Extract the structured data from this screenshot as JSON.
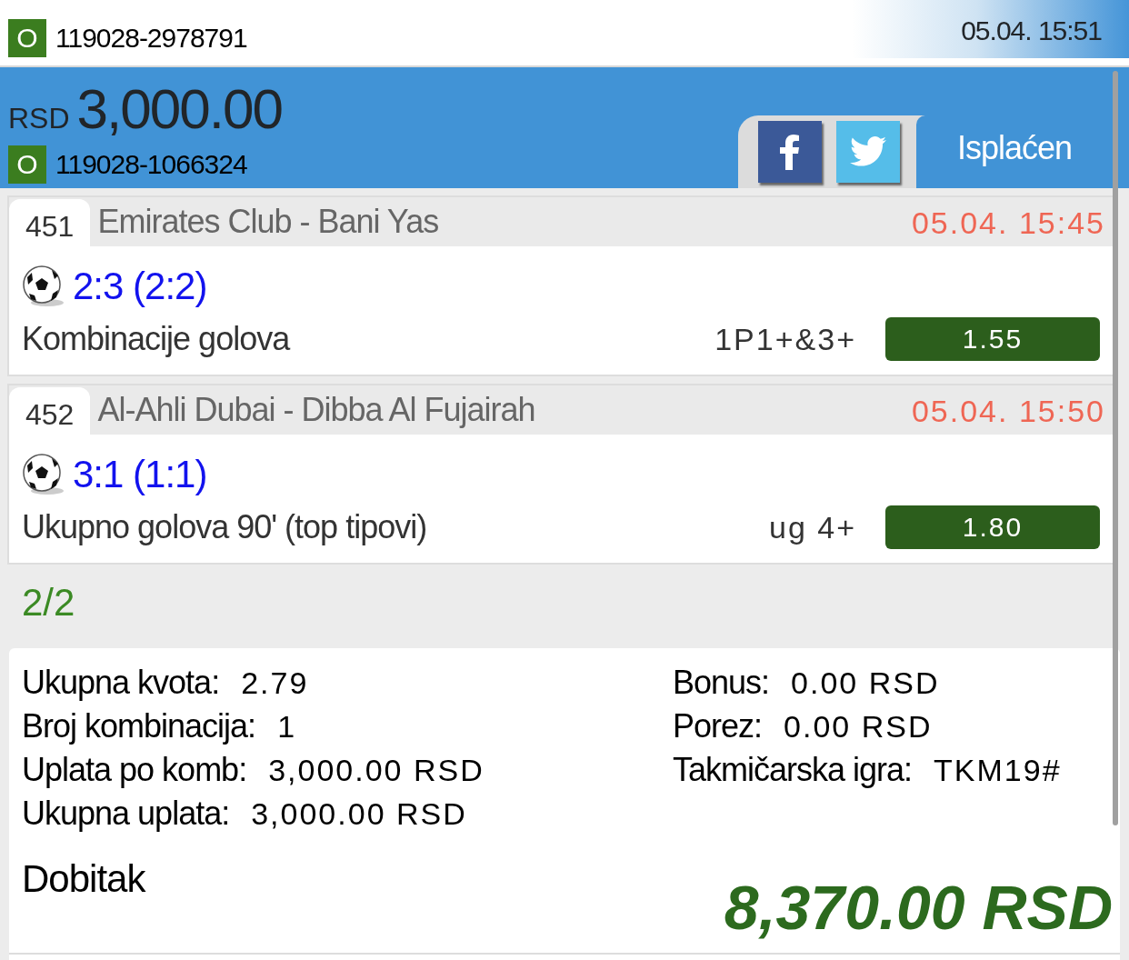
{
  "previous_ticket": {
    "badge": "O",
    "code": "119028-2978791",
    "time": "05.04. 15:51"
  },
  "ticket": {
    "currency": "RSD",
    "amount": "3,000.00",
    "badge": "O",
    "code": "119028-1066324",
    "status": "Isplaćen"
  },
  "events": [
    {
      "number": "451",
      "teams": "Emirates Club - Bani Yas",
      "time": "05.04. 15:45",
      "score": "2:3 (2:2)",
      "market": "Kombinacije golova",
      "pick": "1P1+&3+",
      "odds": "1.55"
    },
    {
      "number": "452",
      "teams": "Al-Ahli Dubai - Dibba Al Fujairah",
      "time": "05.04. 15:50",
      "score": "3:1 (1:1)",
      "market": "Ukupno golova 90' (top tipovi)",
      "pick": "ug 4+",
      "odds": "1.80"
    }
  ],
  "result": "2/2",
  "summary": {
    "left": [
      {
        "label": "Ukupna kvota:",
        "value": "2.79"
      },
      {
        "label": "Broj kombinacija:",
        "value": "1"
      },
      {
        "label": "Uplata po komb:",
        "value": "3,000.00 RSD"
      },
      {
        "label": "Ukupna uplata:",
        "value": "3,000.00 RSD"
      }
    ],
    "right": [
      {
        "label": "Bonus:",
        "value": "0.00 RSD"
      },
      {
        "label": "Porez:",
        "value": "0.00 RSD"
      },
      {
        "label": "Takmičarska igra:",
        "value": "TKM19#"
      }
    ]
  },
  "win": {
    "label": "Dobitak",
    "amount": "8,370.00 RSD"
  }
}
